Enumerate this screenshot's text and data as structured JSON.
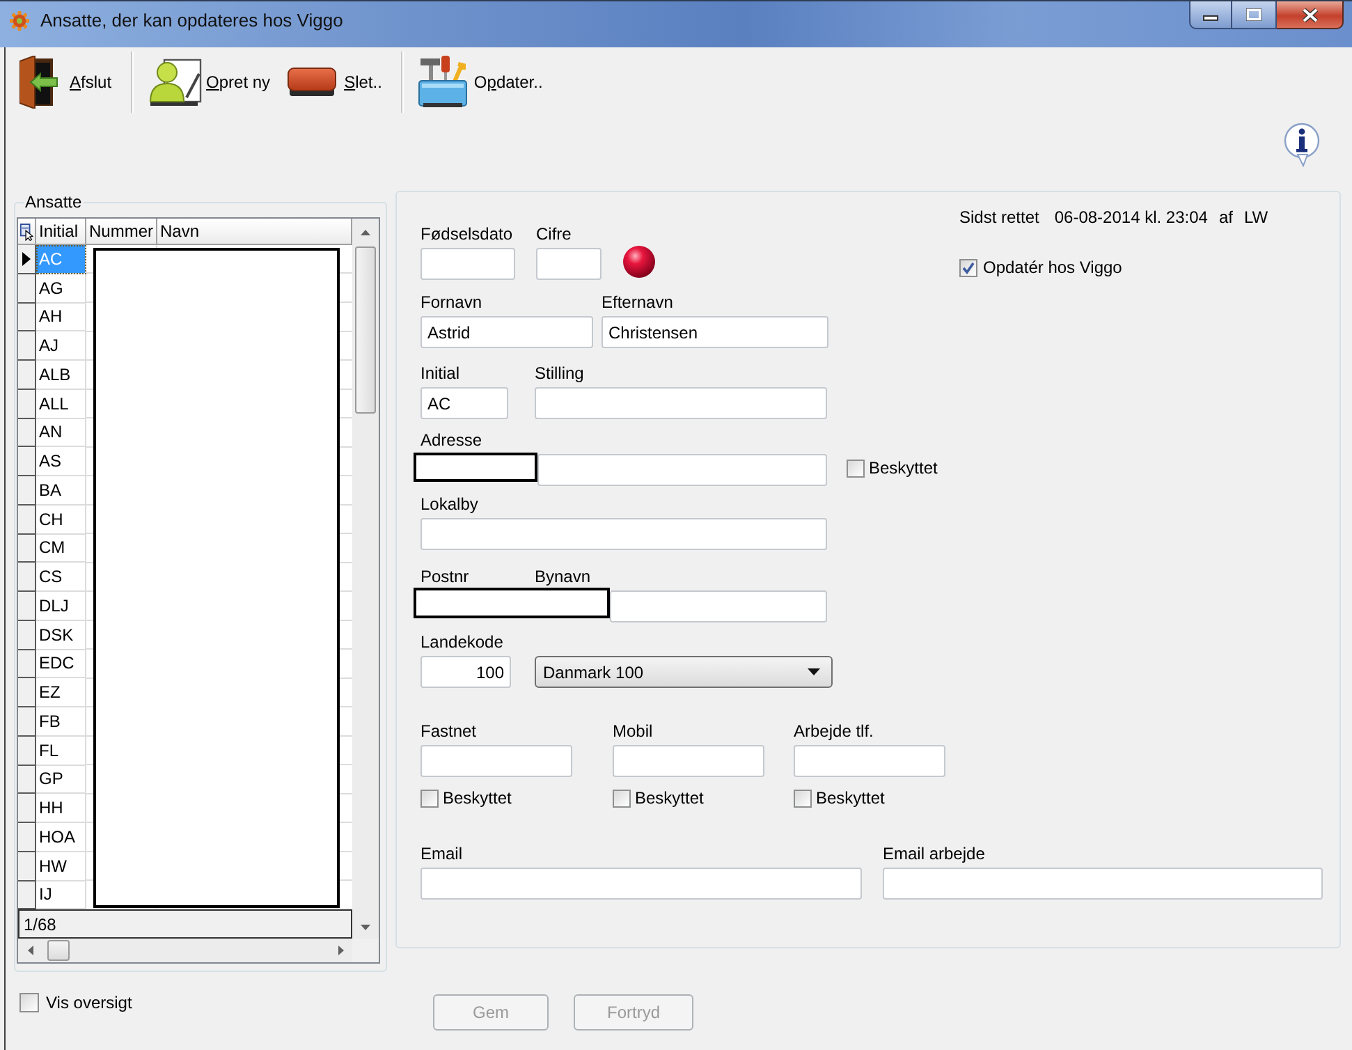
{
  "window": {
    "title": "Ansatte, der kan opdateres hos Viggo"
  },
  "toolbar": {
    "groups": [
      {
        "buttons": [
          {
            "kind": "exit",
            "label": [
              {
                "text": "A",
                "underline": true
              },
              {
                "text": "fslut",
                "underline": false
              }
            ]
          }
        ]
      },
      {
        "buttons": [
          {
            "kind": "new",
            "label": [
              {
                "text": "O",
                "underline": true
              },
              {
                "text": "pret ny",
                "underline": false
              }
            ]
          },
          {
            "kind": "delete",
            "label": [
              {
                "text": "S",
                "underline": true
              },
              {
                "text": "let..",
                "underline": false
              }
            ]
          }
        ]
      },
      {
        "buttons": [
          {
            "kind": "update",
            "label": [
              {
                "text": "O",
                "underline": false
              },
              {
                "text": "p",
                "underline": true
              },
              {
                "text": "dater..",
                "underline": false
              }
            ]
          }
        ]
      }
    ]
  },
  "employees": {
    "title": "Ansatte",
    "columns": [
      "Initial",
      "Nummer",
      "Navn"
    ],
    "rows": [
      {
        "initial": "AC",
        "selected": true
      },
      {
        "initial": "AG",
        "selected": false
      },
      {
        "initial": "AH",
        "selected": false
      },
      {
        "initial": "AJ",
        "selected": false
      },
      {
        "initial": "ALB",
        "selected": false
      },
      {
        "initial": "ALL",
        "selected": false
      },
      {
        "initial": "AN",
        "selected": false
      },
      {
        "initial": "AS",
        "selected": false
      },
      {
        "initial": "BA",
        "selected": false
      },
      {
        "initial": "CH",
        "selected": false
      },
      {
        "initial": "CM",
        "selected": false
      },
      {
        "initial": "CS",
        "selected": false
      },
      {
        "initial": "DLJ",
        "selected": false
      },
      {
        "initial": "DSK",
        "selected": false
      },
      {
        "initial": "EDC",
        "selected": false
      },
      {
        "initial": "EZ",
        "selected": false
      },
      {
        "initial": "FB",
        "selected": false
      },
      {
        "initial": "FL",
        "selected": false
      },
      {
        "initial": "GP",
        "selected": false
      },
      {
        "initial": "HH",
        "selected": false
      },
      {
        "initial": "HOA",
        "selected": false
      },
      {
        "initial": "HW",
        "selected": false
      },
      {
        "initial": "IJ",
        "selected": false
      }
    ],
    "record_counter": "1/68"
  },
  "show_overview": {
    "label": "Vis oversigt",
    "checked": false
  },
  "record": {
    "last_modified": {
      "label": "Sidst rettet",
      "value": "06-08-2014 kl. 23:04",
      "by_label": "af",
      "by": "LW"
    },
    "update_in_viggo": {
      "label": "Opdatér hos Viggo",
      "checked": true
    },
    "rows": [
      {
        "fields": [
          {
            "kind": "text",
            "label": "Fødselsdato"
          },
          {
            "kind": "text",
            "label": "Cifre"
          }
        ]
      },
      {
        "fields": [
          {
            "kind": "text",
            "label": "Fornavn",
            "value": "Astrid"
          },
          {
            "kind": "text",
            "label": "Efternavn",
            "value": "Christensen"
          }
        ]
      },
      {
        "fields": [
          {
            "kind": "text",
            "label": "Initial",
            "value": "AC"
          },
          {
            "kind": "text",
            "label": "Stilling"
          }
        ]
      },
      {
        "fields": [
          {
            "kind": "text",
            "label": "Adresse",
            "protected": {
              "label": "Beskyttet",
              "checked": false
            }
          }
        ]
      },
      {
        "fields": [
          {
            "kind": "text",
            "label": "Lokalby"
          }
        ]
      },
      {
        "fields": [
          {
            "label": "Postnr"
          },
          {
            "kind": "text",
            "label": "Bynavn"
          }
        ]
      },
      {
        "fields": [
          {
            "kind": "number",
            "label": "Landekode",
            "value": "100"
          },
          {
            "kind": "dropdown",
            "value": "Danmark 100"
          }
        ]
      },
      {
        "fields": [
          {
            "kind": "text",
            "label": "Fastnet",
            "protected": {
              "label": "Beskyttet",
              "checked": false
            }
          },
          {
            "kind": "text",
            "label": "Mobil",
            "protected": {
              "label": "Beskyttet",
              "checked": false
            }
          },
          {
            "kind": "text",
            "label": "Arbejde tlf.",
            "protected": {
              "label": "Beskyttet",
              "checked": false
            }
          }
        ]
      },
      {
        "fields": [
          {
            "kind": "text",
            "label": "Email"
          },
          {
            "kind": "text",
            "label": "Email arbejde"
          }
        ]
      }
    ]
  },
  "buttons": [
    {
      "label": "Gem",
      "disabled": true
    },
    {
      "label": "Fortryd",
      "disabled": true
    }
  ]
}
